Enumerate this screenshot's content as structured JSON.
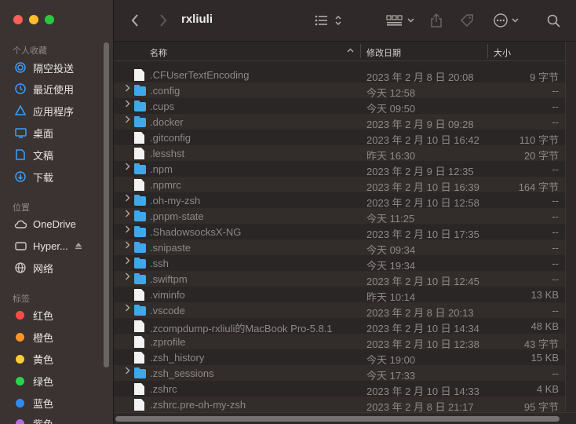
{
  "window": {
    "title": "rxliuli"
  },
  "sidebar": {
    "favorites_title": "个人收藏",
    "favorites": [
      {
        "label": "隔空投送",
        "icon": "airdrop-icon"
      },
      {
        "label": "最近使用",
        "icon": "clock-icon"
      },
      {
        "label": "应用程序",
        "icon": "applications-icon"
      },
      {
        "label": "桌面",
        "icon": "desktop-icon"
      },
      {
        "label": "文稿",
        "icon": "document-icon"
      },
      {
        "label": "下载",
        "icon": "download-icon"
      }
    ],
    "locations_title": "位置",
    "locations": [
      {
        "label": "OneDrive",
        "icon": "cloud-icon"
      },
      {
        "label": "Hyper...",
        "icon": "disk-icon"
      },
      {
        "label": "网络",
        "icon": "network-icon"
      }
    ],
    "tags_title": "标签",
    "tags": [
      {
        "label": "红色",
        "color": "#fe4a49"
      },
      {
        "label": "橙色",
        "color": "#fd9426"
      },
      {
        "label": "黄色",
        "color": "#fecd2f"
      },
      {
        "label": "绿色",
        "color": "#2bd24b"
      },
      {
        "label": "蓝色",
        "color": "#2e8cf5"
      },
      {
        "label": "紫色",
        "color": "#b36ae2"
      }
    ]
  },
  "toolbar": {
    "back_icon": "chevron-left-icon",
    "forward_icon": "chevron-right-icon",
    "view_icon": "list-view-icon",
    "group_icon": "grid-group-icon",
    "share_icon": "share-icon",
    "tag_icon": "tag-icon",
    "more_icon": "ellipsis-icon",
    "search_icon": "search-icon"
  },
  "columns": {
    "name": "名称",
    "date": "修改日期",
    "size": "大小"
  },
  "files": [
    {
      "name": ".CFUserTextEncoding",
      "date": "2023 年 2 月 8 日 20:08",
      "size": "9 字节",
      "folder": false
    },
    {
      "name": ".config",
      "date": "今天 12:58",
      "size": "--",
      "folder": true
    },
    {
      "name": ".cups",
      "date": "今天 09:50",
      "size": "--",
      "folder": true
    },
    {
      "name": ".docker",
      "date": "2023 年 2 月 9 日 09:28",
      "size": "--",
      "folder": true
    },
    {
      "name": ".gitconfig",
      "date": "2023 年 2 月 10 日 16:42",
      "size": "110 字节",
      "folder": false
    },
    {
      "name": ".lesshst",
      "date": "昨天 16:30",
      "size": "20 字节",
      "folder": false
    },
    {
      "name": ".npm",
      "date": "2023 年 2 月 9 日 12:35",
      "size": "--",
      "folder": true
    },
    {
      "name": ".npmrc",
      "date": "2023 年 2 月 10 日 16:39",
      "size": "164 字节",
      "folder": false
    },
    {
      "name": ".oh-my-zsh",
      "date": "2023 年 2 月 10 日 12:58",
      "size": "--",
      "folder": true
    },
    {
      "name": ".pnpm-state",
      "date": "今天 11:25",
      "size": "--",
      "folder": true
    },
    {
      "name": ".ShadowsocksX-NG",
      "date": "2023 年 2 月 10 日 17:35",
      "size": "--",
      "folder": true
    },
    {
      "name": ".snipaste",
      "date": "今天 09:34",
      "size": "--",
      "folder": true
    },
    {
      "name": ".ssh",
      "date": "今天 19:34",
      "size": "--",
      "folder": true
    },
    {
      "name": ".swiftpm",
      "date": "2023 年 2 月 10 日 12:45",
      "size": "--",
      "folder": true
    },
    {
      "name": ".viminfo",
      "date": "昨天 10:14",
      "size": "13 KB",
      "folder": false
    },
    {
      "name": ".vscode",
      "date": "2023 年 2 月 8 日 20:13",
      "size": "--",
      "folder": true
    },
    {
      "name": ".zcompdump-rxliuli的MacBook Pro-5.8.1",
      "date": "2023 年 2 月 10 日 14:34",
      "size": "48 KB",
      "folder": false
    },
    {
      "name": ".zprofile",
      "date": "2023 年 2 月 10 日 12:38",
      "size": "43 字节",
      "folder": false
    },
    {
      "name": ".zsh_history",
      "date": "今天 19:00",
      "size": "15 KB",
      "folder": false
    },
    {
      "name": ".zsh_sessions",
      "date": "今天 17:33",
      "size": "--",
      "folder": true
    },
    {
      "name": ".zshrc",
      "date": "2023 年 2 月 10 日 14:33",
      "size": "4 KB",
      "folder": false
    },
    {
      "name": ".zshrc.pre-oh-my-zsh",
      "date": "2023 年 2 月 8 日 21:17",
      "size": "95 字节",
      "folder": false
    }
  ]
}
